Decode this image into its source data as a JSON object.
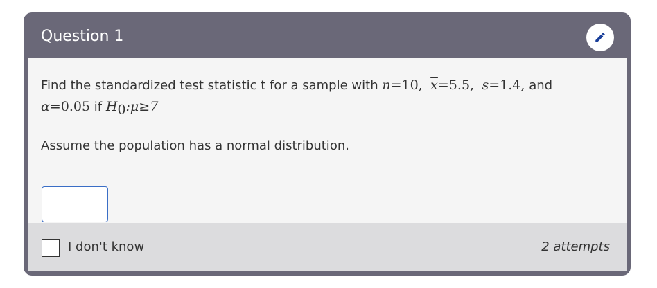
{
  "question": {
    "title": "Question 1",
    "edit_icon": "pencil-icon"
  },
  "prompt": {
    "lead": "Find the standardized test statistic t for a sample with ",
    "n_var": "n",
    "n_eq": "=10,",
    "xbar_var": "x",
    "xbar_eq": "=5.5,",
    "s_var": "s",
    "s_eq": "=1.4,",
    "and_text": " and",
    "alpha_var": "α",
    "alpha_eq": "=0.05",
    "if_text": " if ",
    "h_var": "H",
    "h_sub": "0",
    "h_rest": ":μ≥7"
  },
  "assumption": "Assume the population has a normal distribution.",
  "answer": {
    "value": "",
    "placeholder": ""
  },
  "footer": {
    "idk_label": "I don't know",
    "attempts": "2 attempts"
  },
  "colors": {
    "header_bg": "#6a6878",
    "body_bg": "#f5f5f5",
    "footer_bg": "#dcdcde",
    "edit_icon": "#1a3f9a",
    "input_border": "#3a6ec6"
  }
}
